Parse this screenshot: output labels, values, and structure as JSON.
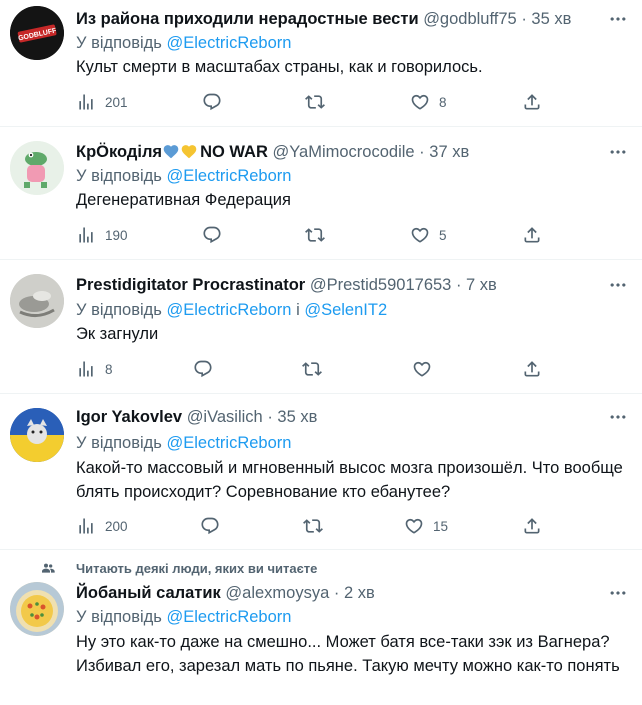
{
  "tweets": [
    {
      "name": "Из района приходили нерадостные вести",
      "handle": "@godbluff75",
      "dot": "·",
      "time": "35 хв",
      "reply_prefix": "У відповідь",
      "mentions": [
        "@ElectricReborn"
      ],
      "body": "Культ смерти в масштабах страны, как и говорилось.",
      "views": "201",
      "likes": "8",
      "avatar_text": "GODBLUFF"
    },
    {
      "name": "КрÖкоділя",
      "name_suffix": "NO WAR",
      "handle": "@YaMimocrocodile",
      "dot": "·",
      "time": "37 хв",
      "reply_prefix": "У відповідь",
      "mentions": [
        "@ElectricReborn"
      ],
      "body": "Дегенеративная Федерация",
      "views": "190",
      "likes": "5"
    },
    {
      "name": "Prestidigitator Procrastinator",
      "handle": "@Prestid59017653",
      "dot": "·",
      "time": "7 хв",
      "reply_prefix": "У відповідь",
      "mentions": [
        "@ElectricReborn",
        "@SelenIT2"
      ],
      "mention_joiner": "і",
      "body": "Эк загнули",
      "views": "8"
    },
    {
      "name": "Igor Yakovlev",
      "handle": "@iVasilich",
      "dot": "·",
      "time": "35 хв",
      "reply_prefix": "У відповідь",
      "mentions": [
        "@ElectricReborn"
      ],
      "body": "Какой-то массовый и мгновенный высос мозга произошёл. Что вообще блять происходит? Соревнование кто ебанутее?",
      "views": "200",
      "likes": "15"
    },
    {
      "context": "Читають деякі люди, яких ви читаєте",
      "name": "Йобаный салатик",
      "handle": "@alexmoysya",
      "dot": "·",
      "time": "2 хв",
      "reply_prefix": "У відповідь",
      "mentions": [
        "@ElectricReborn"
      ],
      "body": "Ну это как-то даже на смешно... Может батя все-таки зэк из Вагнера? Избивал его, зарезал мать по пьяне. Такую мечту можно как-то понять"
    }
  ],
  "colors": {
    "text": "#0f1419",
    "secondary": "#536471",
    "accent": "#1d9bf0",
    "separator": "#eff3f4",
    "heart_blue": "#5b9bd5",
    "heart_yellow": "#f5c431"
  },
  "icons": [
    "views-icon",
    "reply-icon",
    "retweet-icon",
    "like-icon",
    "share-icon",
    "more-icon",
    "people-icon"
  ]
}
